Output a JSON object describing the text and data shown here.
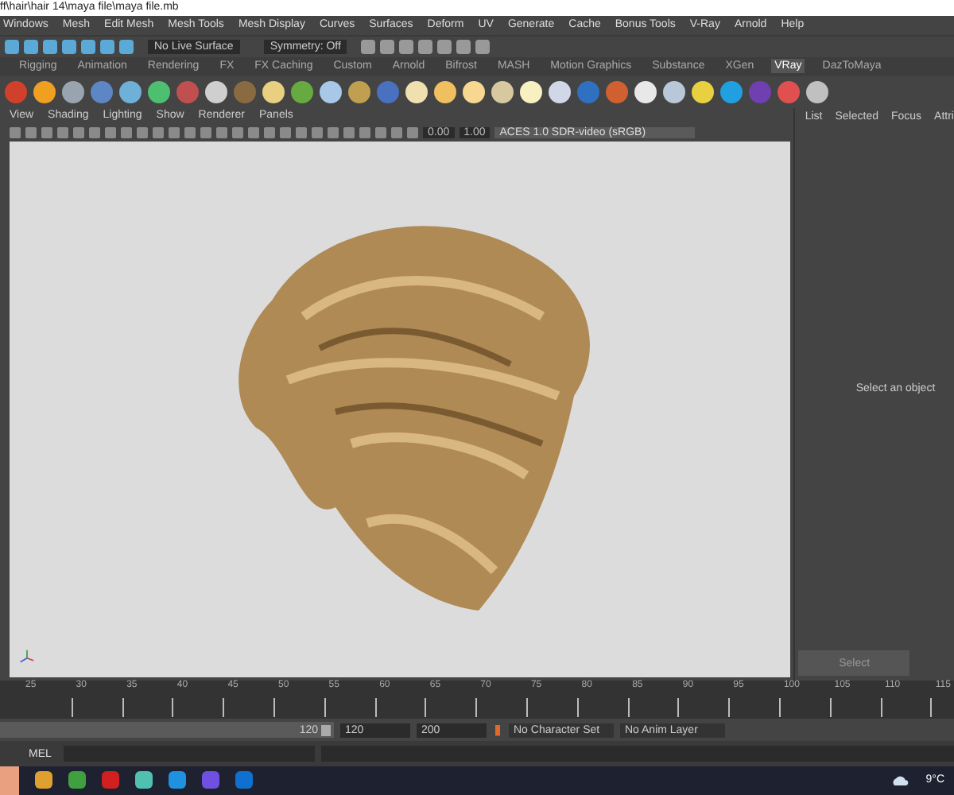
{
  "window": {
    "title": "ff\\hair\\hair 14\\maya file\\maya file.mb"
  },
  "menu": [
    "Windows",
    "Mesh",
    "Edit Mesh",
    "Mesh Tools",
    "Mesh Display",
    "Curves",
    "Surfaces",
    "Deform",
    "UV",
    "Generate",
    "Cache",
    "Bonus Tools",
    "V-Ray",
    "Arnold",
    "Help"
  ],
  "status_line": {
    "live_surface": "No Live Surface",
    "symmetry": "Symmetry: Off"
  },
  "shelf_tabs": [
    {
      "label": "Rigging",
      "selected": false
    },
    {
      "label": "Animation",
      "selected": false
    },
    {
      "label": "Rendering",
      "selected": false
    },
    {
      "label": "FX",
      "selected": false
    },
    {
      "label": "FX Caching",
      "selected": false
    },
    {
      "label": "Custom",
      "selected": false
    },
    {
      "label": "Arnold",
      "selected": false
    },
    {
      "label": "Bifrost",
      "selected": false
    },
    {
      "label": "MASH",
      "selected": false
    },
    {
      "label": "Motion Graphics",
      "selected": false
    },
    {
      "label": "Substance",
      "selected": false
    },
    {
      "label": "XGen",
      "selected": false
    },
    {
      "label": "VRay",
      "selected": true
    },
    {
      "label": "DazToMaya",
      "selected": false
    }
  ],
  "viewport": {
    "menu": [
      "View",
      "Shading",
      "Lighting",
      "Show",
      "Renderer",
      "Panels"
    ],
    "exposure": "0.00",
    "gamma": "1.00",
    "color_space": "ACES 1.0 SDR-video (sRGB)"
  },
  "side_panel": {
    "tabs": [
      "List",
      "Selected",
      "Focus",
      "Attri"
    ],
    "message": "Select an object",
    "button": "Select"
  },
  "timeline": {
    "ticks": [
      "25",
      "30",
      "35",
      "40",
      "45",
      "50",
      "55",
      "60",
      "65",
      "70",
      "75",
      "80",
      "85",
      "90",
      "95",
      "100",
      "105",
      "110",
      "115"
    ]
  },
  "range": {
    "level": 1,
    "slider_end": "120",
    "end": "120",
    "max": "200",
    "character_set": "No Character Set",
    "anim_layer": "No Anim Layer"
  },
  "command_line": {
    "language": "MEL"
  },
  "taskbar": {
    "temperature": "9°C"
  }
}
